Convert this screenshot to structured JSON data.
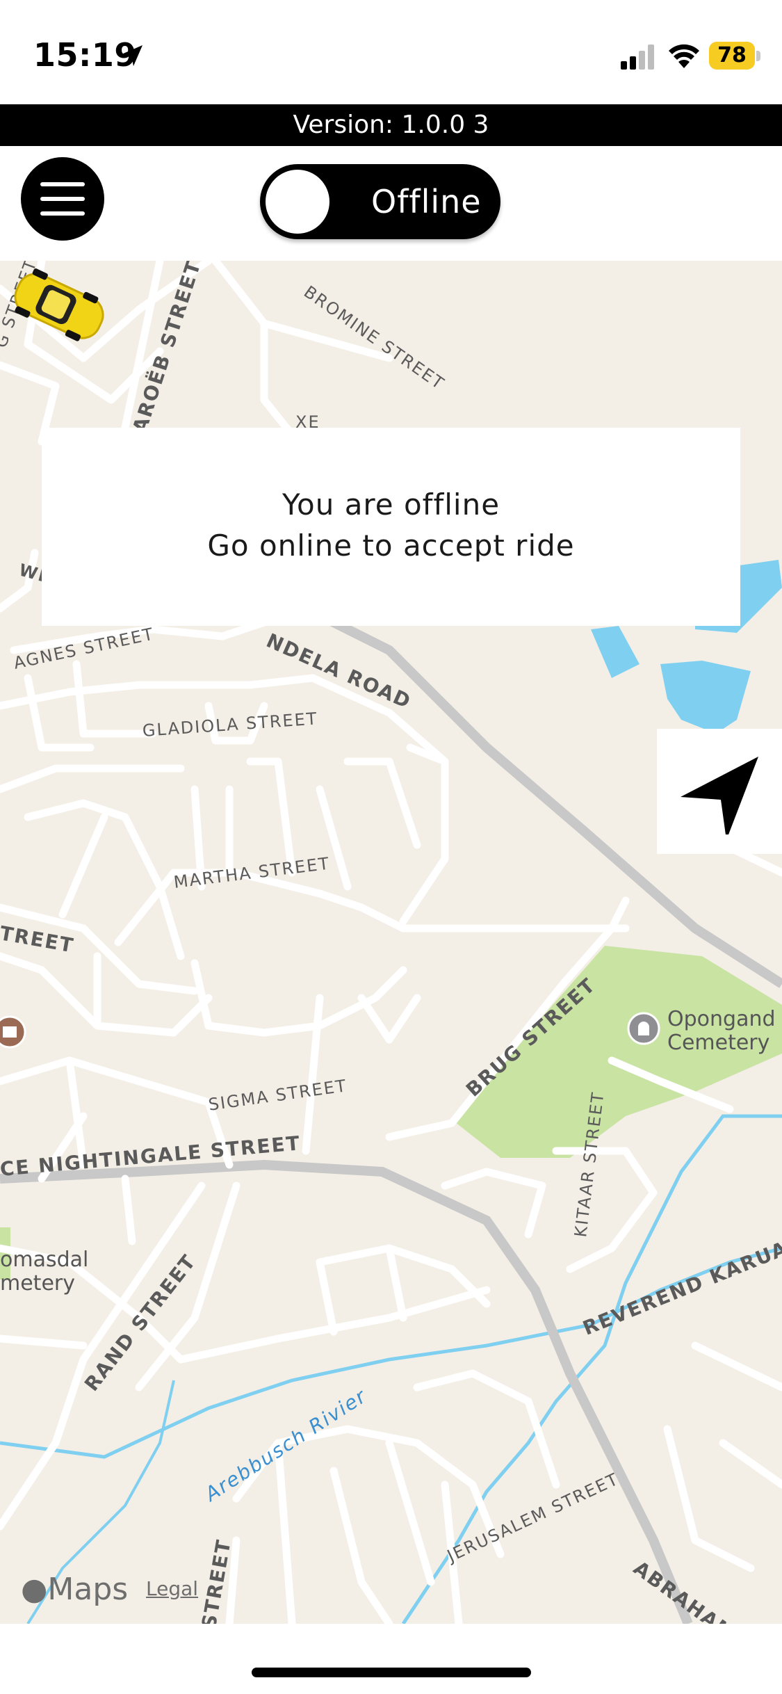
{
  "status_bar": {
    "time": "15:19",
    "battery": "78",
    "battery_color": "#f7cc22"
  },
  "version_bar": {
    "text": "Version: 1.0.0 3"
  },
  "header": {
    "toggle_label": "Offline",
    "toggle_state": "off"
  },
  "offline_message": {
    "line1": "You are offline",
    "line2": "Go online to accept ride"
  },
  "map": {
    "street_labels": [
      "BROMINE STREET",
      "AROËB STREET",
      "G STREET",
      "XE",
      "WI",
      "AGNES STREET",
      "NDELA ROAD",
      "GLADIOLA STREET",
      "MARTHA STREET",
      "TREET",
      "BRUG STREET",
      "SIGMA STREET",
      "CE NIGHTINGALE STREET",
      "KITAAR STREET",
      "RAND STREET",
      "REVEREND KARUAERA",
      "Arebbusch Rivier",
      "JERUSALEM STREET",
      "STREET",
      "ABRAHAM M"
    ],
    "poi": [
      {
        "line1": "Opongand",
        "line2": "Cemetery"
      },
      {
        "line1": "omasdal",
        "line2": "metery"
      }
    ],
    "attribution": {
      "logo": "Maps",
      "legal": "Legal"
    },
    "vehicle_icon": "yellow-car-icon",
    "colors": {
      "land": "#f4efe6",
      "park": "#c9e3a3",
      "water": "#7fcff0",
      "road": "#ffffff",
      "major_road": "#c8c8c8"
    }
  }
}
